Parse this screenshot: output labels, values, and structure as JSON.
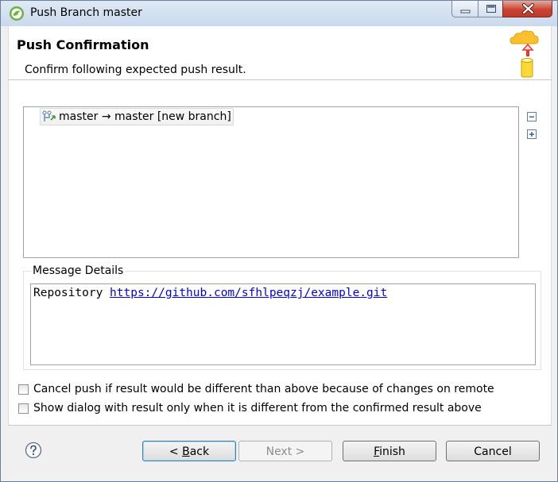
{
  "window": {
    "title": "Push Branch master"
  },
  "banner": {
    "title": "Push Confirmation",
    "description": "Confirm following expected push result."
  },
  "results": {
    "items": [
      {
        "label": "master → master [new branch]",
        "icon": "push-ref-icon"
      }
    ],
    "collapse_all_icon": "collapse-all-icon",
    "expand_all_icon": "expand-all-icon"
  },
  "message_details": {
    "legend": "Message Details",
    "prefix": "Repository ",
    "link": "https://github.com/sfhlpeqzj/example.git"
  },
  "options": {
    "cancel_if_different": {
      "label": "Cancel push if result would be different than above because of changes on remote",
      "checked": false
    },
    "show_only_if_different": {
      "label": "Show dialog with result only when it is different from the confirmed result above",
      "checked": false
    }
  },
  "buttons": {
    "back": {
      "mnemonic_prefix": "< ",
      "mnemonic_char": "B",
      "rest": "ack"
    },
    "next": {
      "label": "Next >",
      "enabled": false
    },
    "finish": {
      "mnemonic_char": "F",
      "rest": "inish"
    },
    "cancel": {
      "label": "Cancel"
    }
  },
  "colors": {
    "link": "#0000ee",
    "close_button": "#c74533"
  }
}
